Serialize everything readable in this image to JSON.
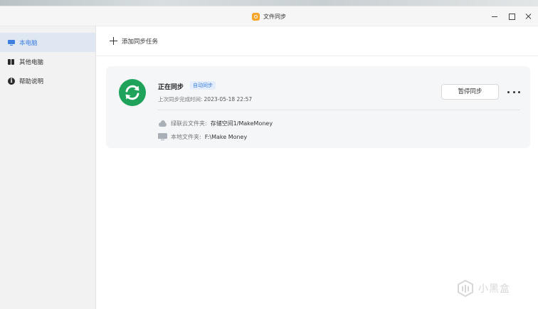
{
  "window": {
    "title": "文件同步"
  },
  "sidebar": {
    "items": [
      {
        "label": "本电脑",
        "icon": "monitor-icon",
        "active": true
      },
      {
        "label": "其他电脑",
        "icon": "devices-icon",
        "active": false
      },
      {
        "label": "帮助说明",
        "icon": "info-icon",
        "active": false
      }
    ]
  },
  "toolbar": {
    "add_task_label": "添加同步任务"
  },
  "task": {
    "status": "正在同步",
    "mode_tag": "自动同步",
    "last_sync_label": "上次同步完成时间:",
    "last_sync_time": "2023-05-18 22:57",
    "pause_label": "暂停同步",
    "cloud_folder_label": "绿联云文件夹:",
    "cloud_folder_path": "存储空间1/MakeMoney",
    "local_folder_label": "本地文件夹:",
    "local_folder_path": "F:\\Make Money"
  },
  "watermark": {
    "text": "小黑盒"
  },
  "colors": {
    "accent": "#3d7fe0",
    "sync_green": "#1fa35b",
    "app_icon": "#f7a52b"
  }
}
